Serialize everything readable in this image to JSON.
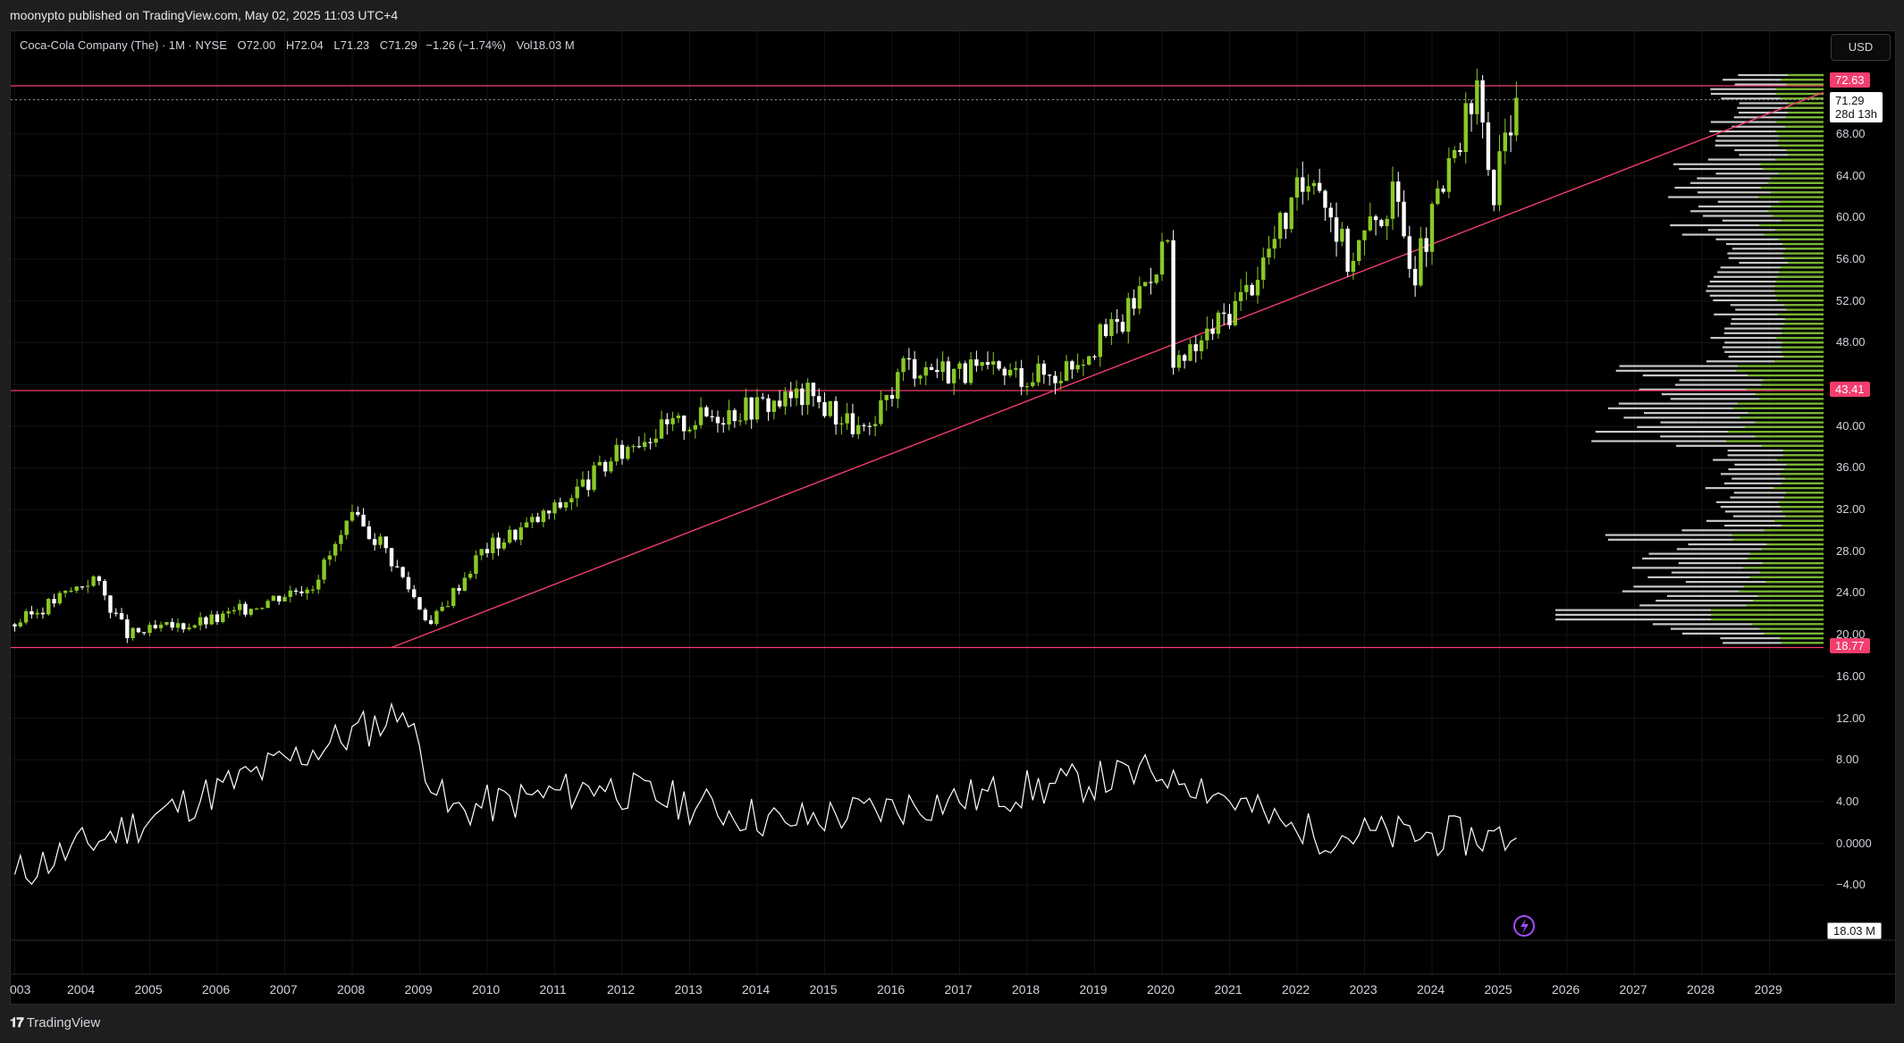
{
  "header": {
    "published_line": "moonypto published on TradingView.com, May 02, 2025 11:03 UTC+4"
  },
  "legend": {
    "symbol": "Coca-Cola Company (The) · 1M · NYSE",
    "open_label": "O",
    "open": "72.00",
    "high_label": "H",
    "high": "72.04",
    "low_label": "L",
    "low": "71.23",
    "close_label": "C",
    "close": "71.29",
    "change": "−1.26 (−1.74%)",
    "vol_label": "Vol",
    "vol": "18.03 M"
  },
  "currency_button": "USD",
  "price_axis": {
    "labels": [
      "68.00",
      "64.00",
      "60.00",
      "56.00",
      "52.00",
      "48.00",
      "40.00",
      "36.00",
      "32.00",
      "28.00",
      "24.00",
      "20.00",
      "16.00",
      "12.00",
      "8.00",
      "4.00",
      "0.0000",
      "−4.00"
    ],
    "tags": {
      "resistance": "72.63",
      "last_price": "71.29",
      "countdown": "28d 13h",
      "middle_level": "43.41",
      "support": "18.77",
      "volume": "18.03 M"
    }
  },
  "time_axis": {
    "labels": [
      "003",
      "2004",
      "2005",
      "2006",
      "2007",
      "2008",
      "2009",
      "2010",
      "2011",
      "2012",
      "2013",
      "2014",
      "2015",
      "2016",
      "2017",
      "2018",
      "2019",
      "2020",
      "2021",
      "2022",
      "2023",
      "2024",
      "2025",
      "2026",
      "2027",
      "2028",
      "2029"
    ]
  },
  "horizontal_levels": [
    72.63,
    43.41,
    18.77
  ],
  "trendline": {
    "from": {
      "date": "2008-08",
      "price": 18.77
    },
    "to": {
      "date": "2029-10",
      "price": 72.0
    }
  },
  "colors": {
    "up": "#8ac926",
    "down": "#ffffff",
    "level": "#f23d6d",
    "background": "#000000",
    "oscillator": "#ffffff",
    "volume_profile_up": "#76b82a",
    "volume_profile_down": "#c8c8c8"
  },
  "chart_data": {
    "type": "candlestick",
    "interval": "1M",
    "ylim": [
      -6,
      76
    ],
    "xlim": [
      "2003",
      "2030"
    ],
    "approx_monthly_closes": [
      {
        "date": "2003-01",
        "close": 21
      },
      {
        "date": "2004-03",
        "close": 25.5
      },
      {
        "date": "2004-09",
        "close": 20
      },
      {
        "date": "2006-01",
        "close": 21.5
      },
      {
        "date": "2007-06",
        "close": 25
      },
      {
        "date": "2008-01",
        "close": 31
      },
      {
        "date": "2008-06",
        "close": 29
      },
      {
        "date": "2009-03",
        "close": 21
      },
      {
        "date": "2009-12",
        "close": 28
      },
      {
        "date": "2011-01",
        "close": 32
      },
      {
        "date": "2012-04",
        "close": 39
      },
      {
        "date": "2013-04",
        "close": 41
      },
      {
        "date": "2014-10",
        "close": 43
      },
      {
        "date": "2015-09",
        "close": 39
      },
      {
        "date": "2016-03",
        "close": 46
      },
      {
        "date": "2017-06",
        "close": 45
      },
      {
        "date": "2018-06",
        "close": 45
      },
      {
        "date": "2019-06",
        "close": 50
      },
      {
        "date": "2020-02",
        "close": 58
      },
      {
        "date": "2020-03",
        "close": 45
      },
      {
        "date": "2021-04",
        "close": 53
      },
      {
        "date": "2022-04",
        "close": 65
      },
      {
        "date": "2022-10",
        "close": 56
      },
      {
        "date": "2023-06",
        "close": 62
      },
      {
        "date": "2023-10",
        "close": 55
      },
      {
        "date": "2024-09",
        "close": 72
      },
      {
        "date": "2024-12",
        "close": 62
      },
      {
        "date": "2025-04",
        "close": 72.5
      },
      {
        "date": "2025-05",
        "close": 71.29
      }
    ],
    "oscillator_approx": [
      {
        "date": "2003",
        "value": -3
      },
      {
        "date": "2008-10",
        "value": 12.5
      },
      {
        "date": "2009-06",
        "value": 3
      },
      {
        "date": "2011-09",
        "value": 5.5
      },
      {
        "date": "2014-06",
        "value": 2
      },
      {
        "date": "2020-03",
        "value": 7
      },
      {
        "date": "2022-01",
        "value": 1
      },
      {
        "date": "2025-04",
        "value": 0.5
      },
      {
        "date": "2025-05",
        "value": -6
      }
    ]
  }
}
